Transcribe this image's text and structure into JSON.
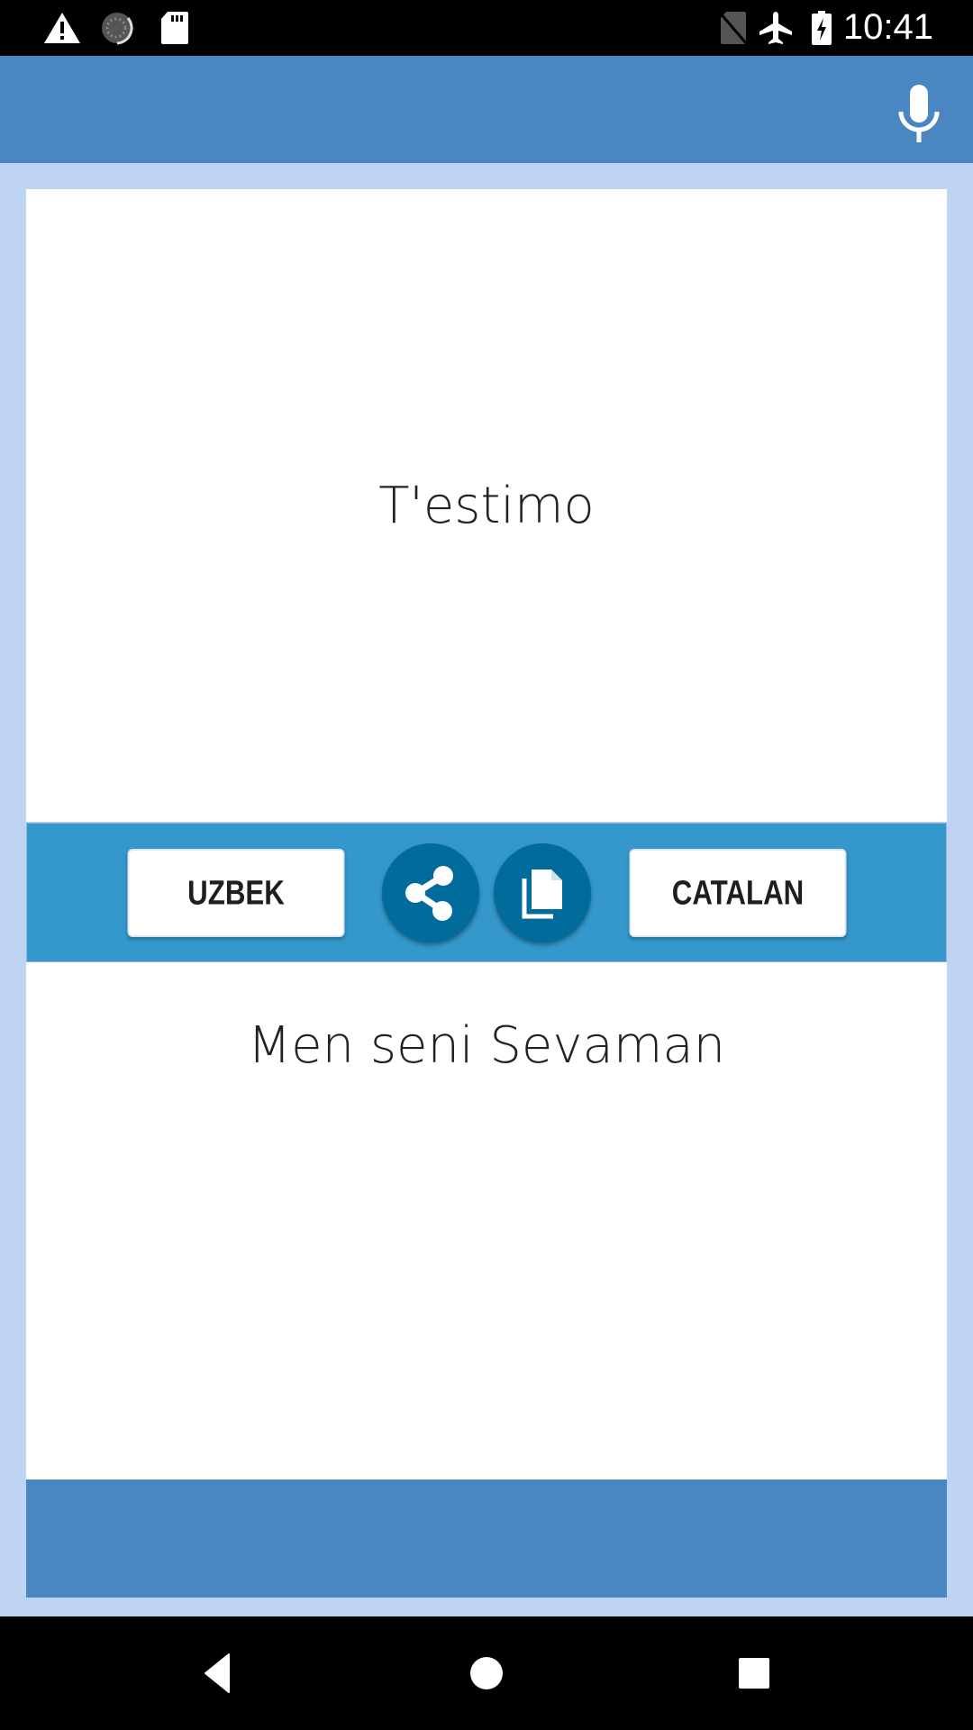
{
  "status_bar": {
    "time": "10:41",
    "left_icons": [
      "warning-icon",
      "sync-icon",
      "sd-card-icon"
    ],
    "right_icons": [
      "no-sim-icon",
      "airplane-mode-icon",
      "battery-charging-icon"
    ]
  },
  "app_bar": {
    "actions": [
      {
        "icon": "microphone-icon",
        "label": "Voice input"
      }
    ]
  },
  "translation": {
    "source_text": "T'estimo",
    "target_text": "Men seni Sevaman"
  },
  "toolbar": {
    "left_language": "UZBEK",
    "right_language": "CATALAN",
    "share_icon": "share-icon",
    "copy_icon": "copy-icon"
  },
  "nav_bar": {
    "buttons": [
      "back",
      "home",
      "recents"
    ]
  },
  "colors": {
    "app_bar": "#4a86c2",
    "background": "#bfd3f2",
    "toolbar": "#3498cc",
    "round_button": "#016c9c"
  }
}
